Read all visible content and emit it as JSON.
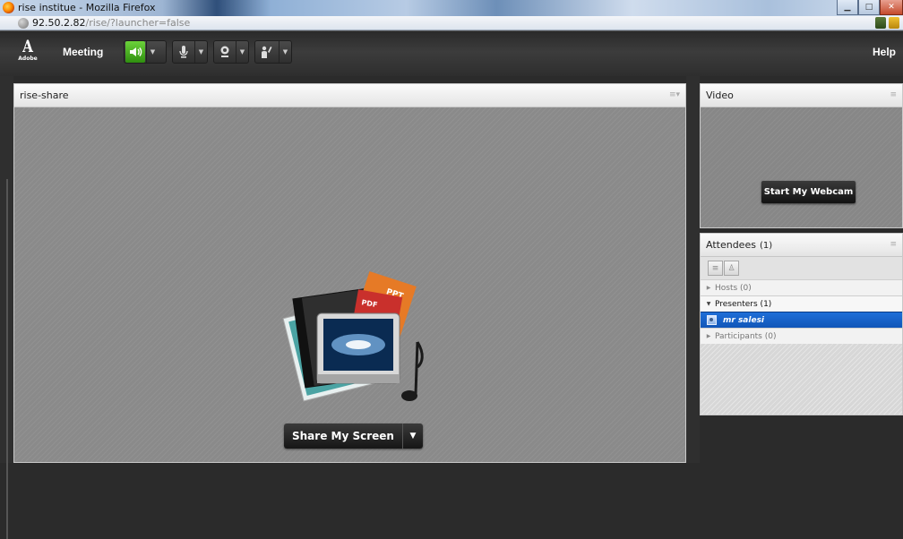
{
  "window": {
    "title": "rise institue - Mozilla Firefox",
    "controls": [
      "minimize-icon",
      "maximize-icon",
      "close-icon"
    ]
  },
  "urlbar": {
    "host": "92.50.2.82",
    "path": "/rise/?launcher=false"
  },
  "appbar": {
    "logo_text": "Adobe",
    "menu_meeting": "Meeting",
    "menu_help": "Help",
    "tools": [
      {
        "name": "speaker-icon",
        "state": "on",
        "color": "#4caf24"
      },
      {
        "name": "microphone-icon",
        "state": "off"
      },
      {
        "name": "webcam-icon",
        "state": "off"
      },
      {
        "name": "raise-hand-icon",
        "state": "off"
      }
    ]
  },
  "share_pod": {
    "title": "rise-share",
    "illustration_labels": {
      "ppt": "PPT",
      "pdf": "PDF"
    },
    "button_label": "Share My Screen"
  },
  "video_pod": {
    "title": "Video",
    "button_label": "Start My Webcam"
  },
  "attendees_pod": {
    "title": "Attendees",
    "count": "(1)",
    "groups": [
      {
        "label": "Hosts (0)",
        "expanded": false
      },
      {
        "label": "Presenters (1)",
        "expanded": true,
        "members": [
          "mr salesi"
        ]
      },
      {
        "label": "Participants (0)",
        "expanded": false
      }
    ],
    "selected_color": "#1560c8"
  }
}
